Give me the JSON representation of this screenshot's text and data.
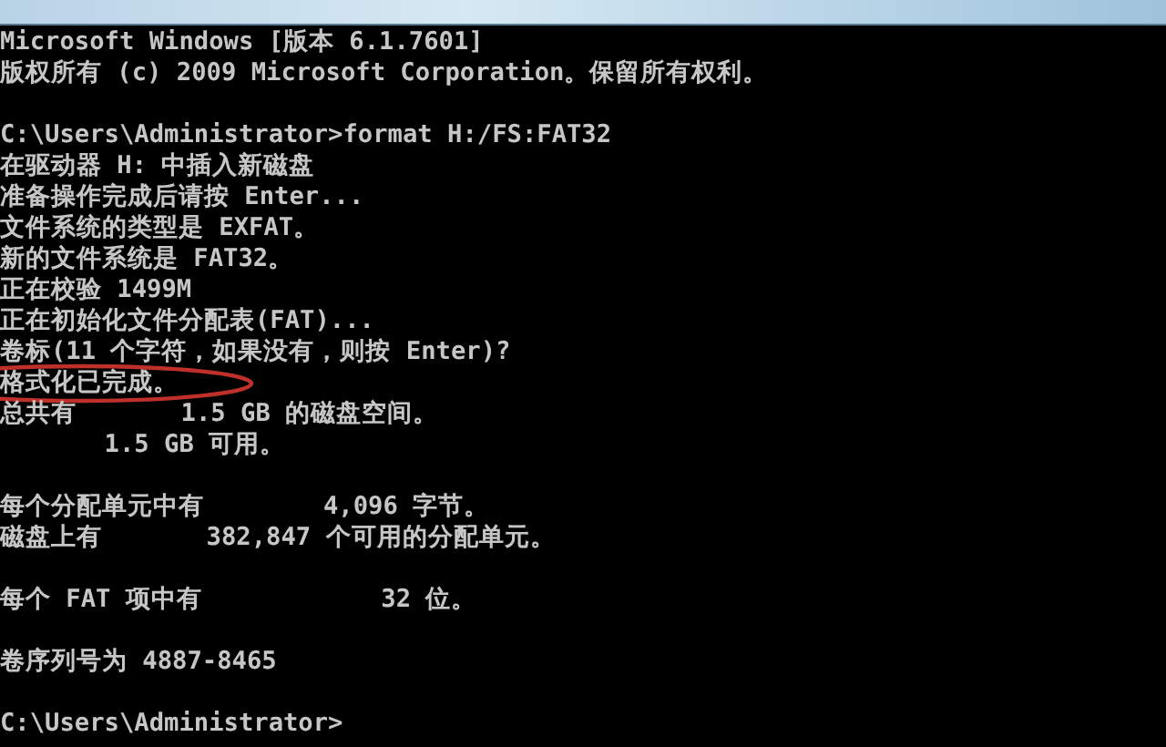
{
  "console": {
    "blocks": [
      [
        {
          "text": "Microsoft Windows [版本 6.1.7601]",
          "circled": false
        },
        {
          "text": "版权所有 (c) 2009 Microsoft Corporation。保留所有权利。",
          "circled": false
        }
      ],
      [
        {
          "text": "C:\\Users\\Administrator>format H:/FS:FAT32",
          "circled": false
        },
        {
          "text": "在驱动器 H: 中插入新磁盘",
          "circled": false
        },
        {
          "text": "准备操作完成后请按 Enter...",
          "circled": false
        },
        {
          "text": "文件系统的类型是 EXFAT。",
          "circled": false
        },
        {
          "text": "新的文件系统是 FAT32。",
          "circled": false
        },
        {
          "text": "正在校验 1499M",
          "circled": false
        },
        {
          "text": "正在初始化文件分配表(FAT)...",
          "circled": false
        },
        {
          "text": "卷标(11 个字符，如果没有，则按 Enter)?",
          "circled": false
        },
        {
          "text": "格式化已完成。",
          "circled": true
        },
        {
          "text": "总共有       1.5 GB 的磁盘空间。",
          "circled": false
        },
        {
          "text": "       1.5 GB 可用。",
          "circled": false
        }
      ],
      [
        {
          "text": "每个分配单元中有        4,096 字节。",
          "circled": false
        },
        {
          "text": "磁盘上有       382,847 个可用的分配单元。",
          "circled": false
        }
      ],
      [
        {
          "text": "每个 FAT 项中有            32 位。",
          "circled": false
        }
      ],
      [
        {
          "text": "卷序列号为 4887-8465",
          "circled": false
        }
      ],
      [
        {
          "text": "C:\\Users\\Administrator>",
          "circled": false
        }
      ]
    ]
  }
}
